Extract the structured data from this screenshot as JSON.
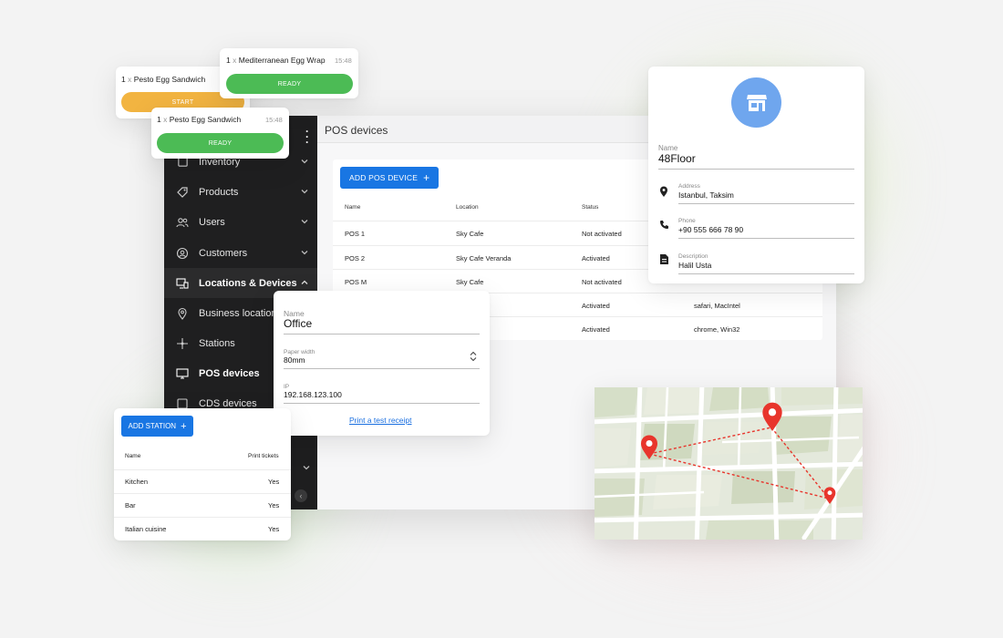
{
  "tickets": [
    {
      "qty": "1",
      "x": "x",
      "item": "Pesto Egg Sandwich",
      "button": "START",
      "button_color": "#f2b441"
    },
    {
      "qty": "1",
      "x": "x",
      "item": "Mediterranean Egg Wrap",
      "time": "15:48",
      "button": "READY",
      "button_color": "#4cbb55"
    },
    {
      "qty": "1",
      "x": "x",
      "item": "Pesto Egg Sandwich",
      "time": "15:48",
      "button": "READY",
      "button_color": "#4cbb55"
    }
  ],
  "sidebar": {
    "items": [
      {
        "label": "Inventory",
        "icon": "inventory-icon"
      },
      {
        "label": "Products",
        "icon": "tag-icon"
      },
      {
        "label": "Users",
        "icon": "users-icon"
      },
      {
        "label": "Customers",
        "icon": "customer-icon"
      },
      {
        "label": "Locations & Devices",
        "icon": "devices-icon"
      },
      {
        "label": "Business locations",
        "icon": "location-pin-icon"
      },
      {
        "label": "Stations",
        "icon": "stations-icon"
      },
      {
        "label": "POS devices",
        "icon": "pos-monitor-icon"
      },
      {
        "label": "CDS devices",
        "icon": "cds-icon"
      }
    ]
  },
  "main": {
    "title": "POS devices",
    "add_button": "ADD POS DEVICE",
    "columns": [
      "Name",
      "Location",
      "Status"
    ],
    "rows": [
      {
        "name": "POS 1",
        "location": "Sky Cafe",
        "status": "Not activated",
        "extra": ""
      },
      {
        "name": "POS 2",
        "location": "Sky Cafe Veranda",
        "status": "Activated",
        "extra": ""
      },
      {
        "name": "POS M",
        "location": "Sky Cafe",
        "status": "Not activated",
        "extra": ""
      },
      {
        "name": "",
        "location": "",
        "status": "Activated",
        "extra": "safari, MacIntel"
      },
      {
        "name": "",
        "location": "",
        "status": "Activated",
        "extra": "chrome, Win32"
      }
    ]
  },
  "location_card": {
    "icon": "store-icon",
    "name_label": "Name",
    "name": "48Floor",
    "address_label": "Address",
    "address": "Istanbul, Taksim",
    "phone_label": "Phone",
    "phone": "+90 555 666 78 90",
    "description_label": "Description",
    "description": "Halil Usta"
  },
  "office_card": {
    "name_label": "Name",
    "name": "Office",
    "paper_label": "Paper width",
    "paper": "80mm",
    "ip_label": "IP",
    "ip": "192.168.123.100",
    "link": "Print a test receipt"
  },
  "stations": {
    "add_button": "ADD STATION",
    "col_name": "Name",
    "col_print": "Print tickets",
    "rows": [
      {
        "name": "Kitchen",
        "print": "Yes"
      },
      {
        "name": "Bar",
        "print": "Yes"
      },
      {
        "name": "Italian cuisine",
        "print": "Yes"
      }
    ]
  },
  "colors": {
    "accent": "#1976e3",
    "sidebar_bg": "#1f1f20",
    "ready": "#4cbb55",
    "start": "#f2b441",
    "map_pin": "#e8352c"
  }
}
